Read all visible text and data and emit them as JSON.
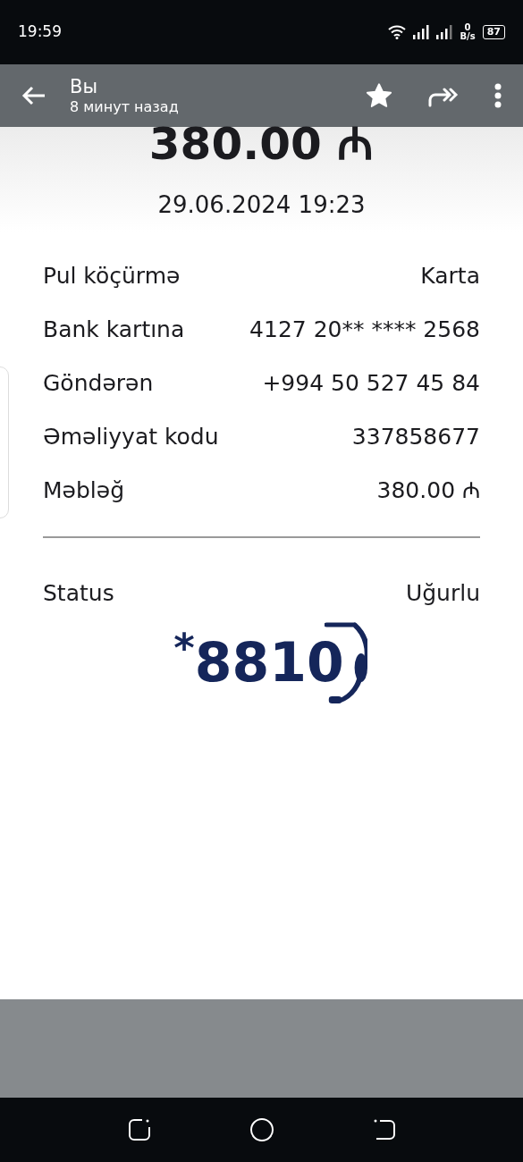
{
  "status_bar": {
    "time": "19:59",
    "speed_value": "0",
    "speed_unit": "B/s",
    "battery": "87"
  },
  "header": {
    "title": "Вы",
    "subtitle": "8 минут назад"
  },
  "receipt": {
    "amount": "380.00 ₼",
    "datetime": "29.06.2024 19:23",
    "rows": [
      {
        "label": "Pul köçürmə",
        "value": "Karta"
      },
      {
        "label": "Bank kartına",
        "value": "4127 20** **** 2568"
      },
      {
        "label": "Göndərən",
        "value": "+994 50 527 45 84"
      },
      {
        "label": "Əməliyyat kodu",
        "value": "337858677"
      },
      {
        "label": "Məbləğ",
        "value": "380.00 ₼"
      }
    ],
    "status": {
      "label": "Status",
      "value": "Uğurlu"
    },
    "hotline": "$^{*}$8810"
  }
}
